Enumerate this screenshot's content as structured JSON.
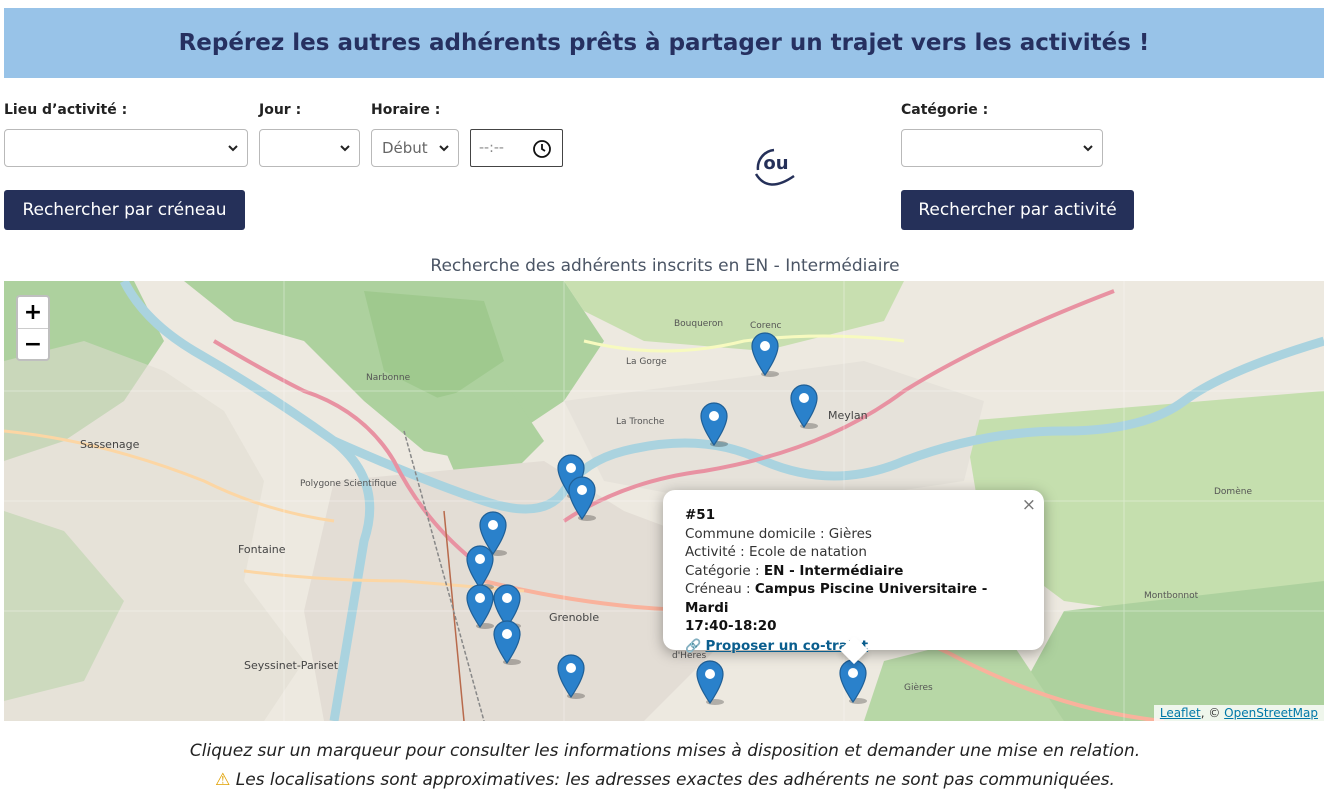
{
  "banner": {
    "title": "Repérez les autres adhérents prêts à partager un trajet vers les activités !"
  },
  "filters": {
    "lieu_label": "Lieu d’activité :",
    "jour_label": "Jour :",
    "horaire_label": "Horaire :",
    "horaire_select_value": "Début",
    "time_placeholder": "--:--",
    "categorie_label": "Catégorie :",
    "search_slot_button": "Rechercher par créneau",
    "search_activity_button": "Rechercher par activité"
  },
  "logo": {
    "text": "ou"
  },
  "map": {
    "heading": "Recherche des adhérents inscrits en EN - Intermédiaire",
    "zoom_in": "+",
    "zoom_out": "−",
    "labels": {
      "sassenage": "Sassenage",
      "fontaine": "Fontaine",
      "grenoble": "Grenoble",
      "meylan": "Meylan",
      "polygone": "Polygone Scientifique",
      "seyssinet": "Seyssinet-Pariset",
      "corenc": "Corenc",
      "tronche": "La Tronche",
      "gieres": "Gières",
      "domene": "Domène",
      "heres": "d'Hères",
      "montbonnot": "Montbonnot",
      "bouqueron": "Bouqueron",
      "narbonne": "Narbonne",
      "gorge": "La Gorge"
    },
    "attribution": {
      "leaflet": "Leaflet",
      "sep": ", © ",
      "osm": "OpenStreetMap"
    },
    "colors": {
      "marker": "#2a81cb",
      "water": "#aad3df",
      "forest": "#add19e",
      "motorway": "#e892a2"
    }
  },
  "popup": {
    "id": "#51",
    "commune_label": "Commune domicile : ",
    "commune_value": "Gières",
    "activite_label": "Activité : ",
    "activite_value": "Ecole de natation",
    "categorie_label": "Catégorie : ",
    "categorie_value": "EN - Intermédiaire",
    "creneau_label": "Créneau : ",
    "creneau_value_1": "Campus Piscine Universitaire - Mardi",
    "creneau_value_2": "17:40-18:20",
    "link_text": "Proposer un co-trajet",
    "close": "×"
  },
  "footer": {
    "line1": "Cliquez sur un marqueur pour consulter les informations mises à disposition et demander une mise en relation.",
    "line2": "Les localisations sont approximatives: les adresses exactes des adhérents ne sont pas communiquées."
  }
}
